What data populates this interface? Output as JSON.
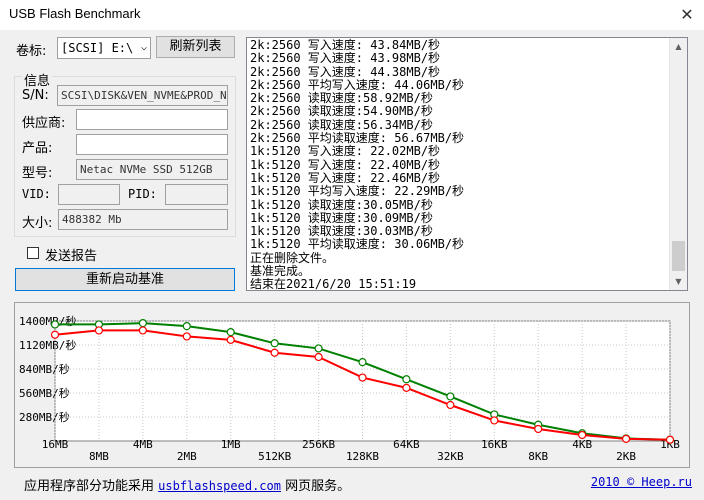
{
  "window": {
    "title": "USB Flash Benchmark",
    "close_glyph": "✕"
  },
  "drive": {
    "label": "卷标:",
    "selected": "[SCSI] E:\\",
    "refresh_button": "刷新列表"
  },
  "info": {
    "group_title": "信息",
    "sn_label": "S/N:",
    "sn_value": "SCSI\\DISK&VEN_NVME&PROD_N",
    "vendor_label": "供应商:",
    "vendor_value": "",
    "product_label": "产品:",
    "product_value": "",
    "model_label": "型号:",
    "model_value": "Netac NVMe SSD 512GB",
    "vid_label": "VID:",
    "vid_value": "",
    "pid_label": "PID:",
    "pid_value": "",
    "size_label": "大小:",
    "size_value": "488382 Mb"
  },
  "send_report": {
    "label": "发送报告",
    "checked": false
  },
  "restart_button": "重新启动基准",
  "log_lines": [
    "2k:2560 写入速度: 43.84MB/秒",
    "2k:2560 写入速度: 43.98MB/秒",
    "2k:2560 写入速度: 44.38MB/秒",
    "2k:2560 平均写入速度: 44.06MB/秒",
    "2k:2560 读取速度:58.92MB/秒",
    "2k:2560 读取速度:54.90MB/秒",
    "2k:2560 读取速度:56.34MB/秒",
    "2k:2560 平均读取速度: 56.67MB/秒",
    "1k:5120 写入速度: 22.02MB/秒",
    "1k:5120 写入速度: 22.40MB/秒",
    "1k:5120 写入速度: 22.46MB/秒",
    "1k:5120 平均写入速度: 22.29MB/秒",
    "1k:5120 读取速度:30.05MB/秒",
    "1k:5120 读取速度:30.09MB/秒",
    "1k:5120 读取速度:30.03MB/秒",
    "1k:5120 平均读取速度: 30.06MB/秒",
    "正在删除文件。",
    "基准完成。",
    "结束在2021/6/20 15:51:19"
  ],
  "chart_data": {
    "type": "line",
    "categories": [
      "16MB",
      "8MB",
      "4MB",
      "2MB",
      "1MB",
      "512KB",
      "256KB",
      "128KB",
      "64KB",
      "32KB",
      "16KB",
      "8KB",
      "4KB",
      "2KB",
      "1KB"
    ],
    "ytick_labels": [
      "1400MB/秒",
      "1120MB/秒",
      "840MB/秒",
      "560MB/秒",
      "280MB/秒"
    ],
    "yticks": [
      1400,
      1120,
      840,
      560,
      280
    ],
    "ylim": [
      0,
      1400
    ],
    "series": [
      {
        "color": "#008000",
        "values": [
          1360,
          1360,
          1375,
          1340,
          1270,
          1140,
          1080,
          920,
          720,
          520,
          310,
          190,
          90,
          30,
          15
        ]
      },
      {
        "color": "#ff0000",
        "values": [
          1240,
          1290,
          1290,
          1220,
          1180,
          1030,
          980,
          740,
          620,
          420,
          240,
          140,
          70,
          25,
          15
        ]
      }
    ],
    "grid": true
  },
  "status": {
    "prefix": "应用程序部分功能采用",
    "link": "usbflashspeed.com",
    "suffix": " 网页服务。",
    "copyright_link": "2010 © Heep.ru"
  }
}
